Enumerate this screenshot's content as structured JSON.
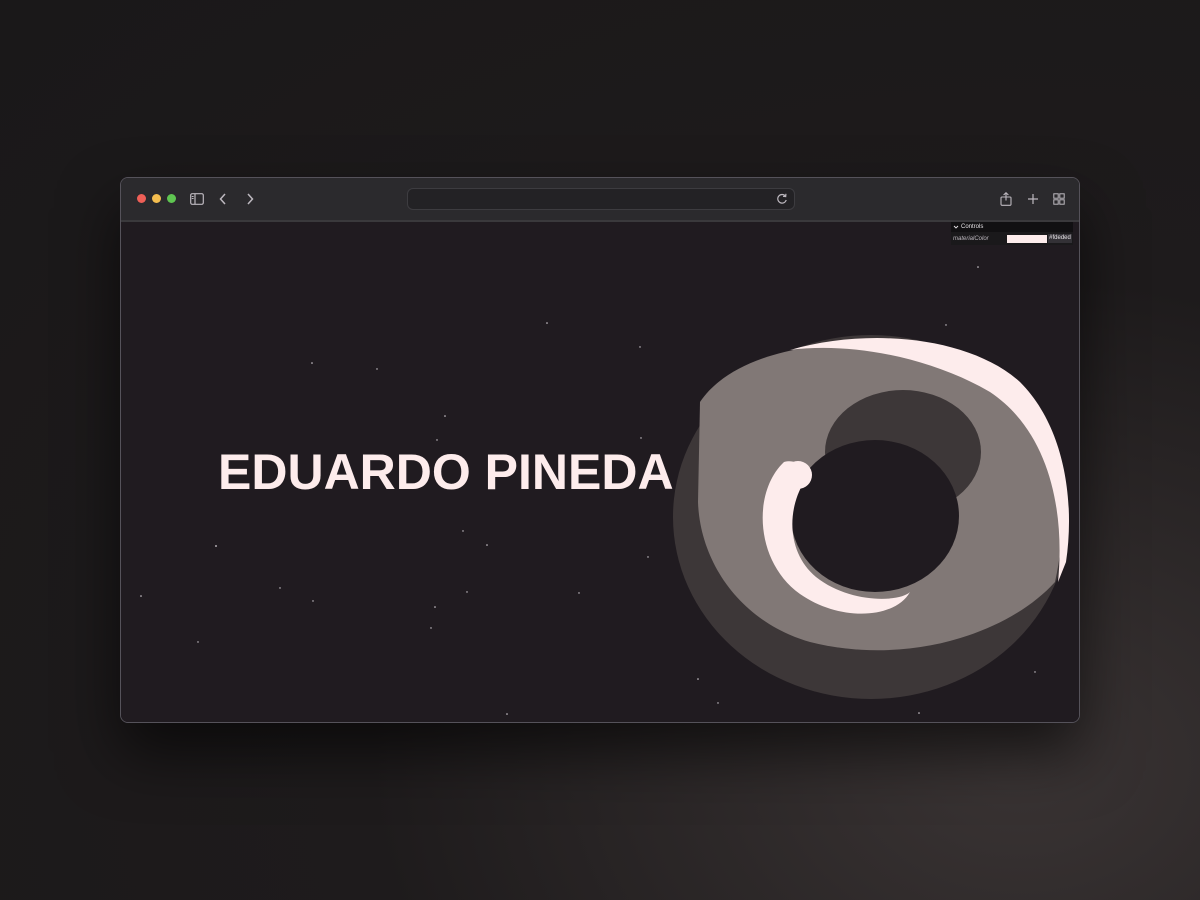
{
  "browser": {
    "address_bar": {
      "url": ""
    },
    "icons": {
      "sidebar": "sidebar-icon",
      "back": "chevron-left-icon",
      "forward": "chevron-right-icon",
      "reload": "reload-icon",
      "share": "share-icon",
      "new_tab": "plus-icon",
      "tabs": "tab-overview-icon"
    },
    "traffic_lights": [
      "#ee5f57",
      "#f4bd4f",
      "#5fc551"
    ]
  },
  "page": {
    "title": "EDUARDO PINEDA",
    "colors": {
      "background": "#201b20",
      "text": "#fdecec",
      "torus_light": "#fdecec",
      "torus_mid": "#817876",
      "torus_dark": "#3d3738"
    }
  },
  "controls_panel": {
    "header": "Controls",
    "material_label": "materialColor",
    "material_value": "#fdecec",
    "material_hex_label": "#fdeded"
  }
}
